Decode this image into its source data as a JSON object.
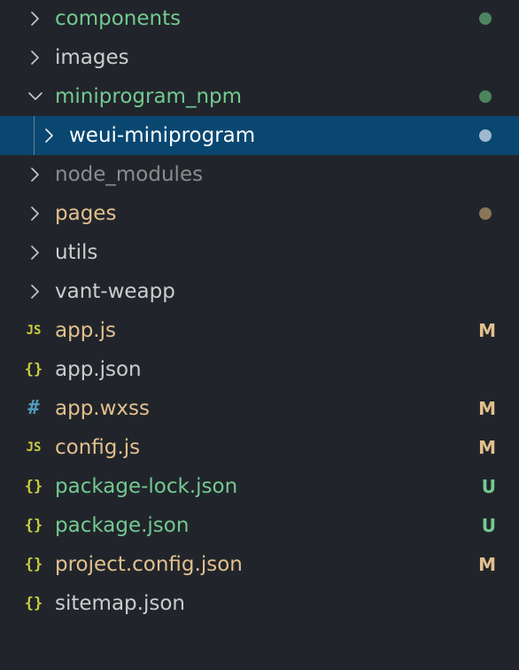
{
  "colors": {
    "background": "#21252b",
    "selected_row": "#094771",
    "untracked_green": "#73c991",
    "modified_tan": "#e2c08d",
    "ignored_gray": "#8c8c8c",
    "default_text": "#cccccc",
    "selected_text": "#ffffff",
    "json_icon": "#cbcb41",
    "js_icon": "#cbcb41",
    "css_icon": "#519aba"
  },
  "explorer": {
    "items": [
      {
        "label": "components",
        "kind": "folder",
        "expanded": false,
        "depth": 0,
        "status": "dot",
        "color": "#73c991",
        "badge_color": "#4d8561",
        "icon": "chevron-right-icon",
        "slug": "components"
      },
      {
        "label": "images",
        "kind": "folder",
        "expanded": false,
        "depth": 0,
        "status": "",
        "color": "#cccccc",
        "icon": "chevron-right-icon",
        "slug": "images"
      },
      {
        "label": "miniprogram_npm",
        "kind": "folder",
        "expanded": true,
        "depth": 0,
        "status": "dot",
        "color": "#73c991",
        "badge_color": "#4d8561",
        "icon": "chevron-down-icon",
        "slug": "miniprogram-npm"
      },
      {
        "label": "weui-miniprogram",
        "kind": "folder",
        "expanded": false,
        "depth": 1,
        "status": "dot",
        "selected": true,
        "color": "#ffffff",
        "badge_color": "#9fb8cf",
        "icon": "chevron-right-icon",
        "slug": "weui-miniprogram"
      },
      {
        "label": "node_modules",
        "kind": "folder",
        "expanded": false,
        "depth": 0,
        "status": "",
        "color": "#8c8c8c",
        "icon": "chevron-right-icon",
        "slug": "node-modules"
      },
      {
        "label": "pages",
        "kind": "folder",
        "expanded": false,
        "depth": 0,
        "status": "dot",
        "color": "#e2c08d",
        "badge_color": "#8a7556",
        "icon": "chevron-right-icon",
        "slug": "pages"
      },
      {
        "label": "utils",
        "kind": "folder",
        "expanded": false,
        "depth": 0,
        "status": "",
        "color": "#cccccc",
        "icon": "chevron-right-icon",
        "slug": "utils"
      },
      {
        "label": "vant-weapp",
        "kind": "folder",
        "expanded": false,
        "depth": 0,
        "status": "",
        "color": "#cccccc",
        "icon": "chevron-right-icon",
        "slug": "vant-weapp"
      },
      {
        "label": "app.js",
        "kind": "file",
        "file_icon": "JS",
        "icon": "js-file-icon",
        "icon_class": "js",
        "status": "M",
        "color": "#e2c08d",
        "badge_color": "#e2c08d",
        "slug": "app-js"
      },
      {
        "label": "app.json",
        "kind": "file",
        "file_icon": "{}",
        "icon": "json-file-icon",
        "icon_class": "json",
        "status": "",
        "color": "#cccccc",
        "slug": "app-json"
      },
      {
        "label": "app.wxss",
        "kind": "file",
        "file_icon": "#",
        "icon": "css-file-icon",
        "icon_class": "css",
        "status": "M",
        "color": "#e2c08d",
        "badge_color": "#e2c08d",
        "slug": "app-wxss"
      },
      {
        "label": "config.js",
        "kind": "file",
        "file_icon": "JS",
        "icon": "js-file-icon",
        "icon_class": "js",
        "status": "M",
        "color": "#e2c08d",
        "badge_color": "#e2c08d",
        "slug": "config-js"
      },
      {
        "label": "package-lock.json",
        "kind": "file",
        "file_icon": "{}",
        "icon": "json-file-icon",
        "icon_class": "json",
        "status": "U",
        "color": "#73c991",
        "badge_color": "#73c991",
        "slug": "package-lock-json"
      },
      {
        "label": "package.json",
        "kind": "file",
        "file_icon": "{}",
        "icon": "json-file-icon",
        "icon_class": "json",
        "status": "U",
        "color": "#73c991",
        "badge_color": "#73c991",
        "slug": "package-json"
      },
      {
        "label": "project.config.json",
        "kind": "file",
        "file_icon": "{}",
        "icon": "json-file-icon",
        "icon_class": "json",
        "status": "M",
        "color": "#e2c08d",
        "badge_color": "#e2c08d",
        "slug": "project-config-json"
      },
      {
        "label": "sitemap.json",
        "kind": "file",
        "file_icon": "{}",
        "icon": "json-file-icon",
        "icon_class": "json",
        "status": "",
        "color": "#cccccc",
        "slug": "sitemap-json"
      }
    ]
  }
}
